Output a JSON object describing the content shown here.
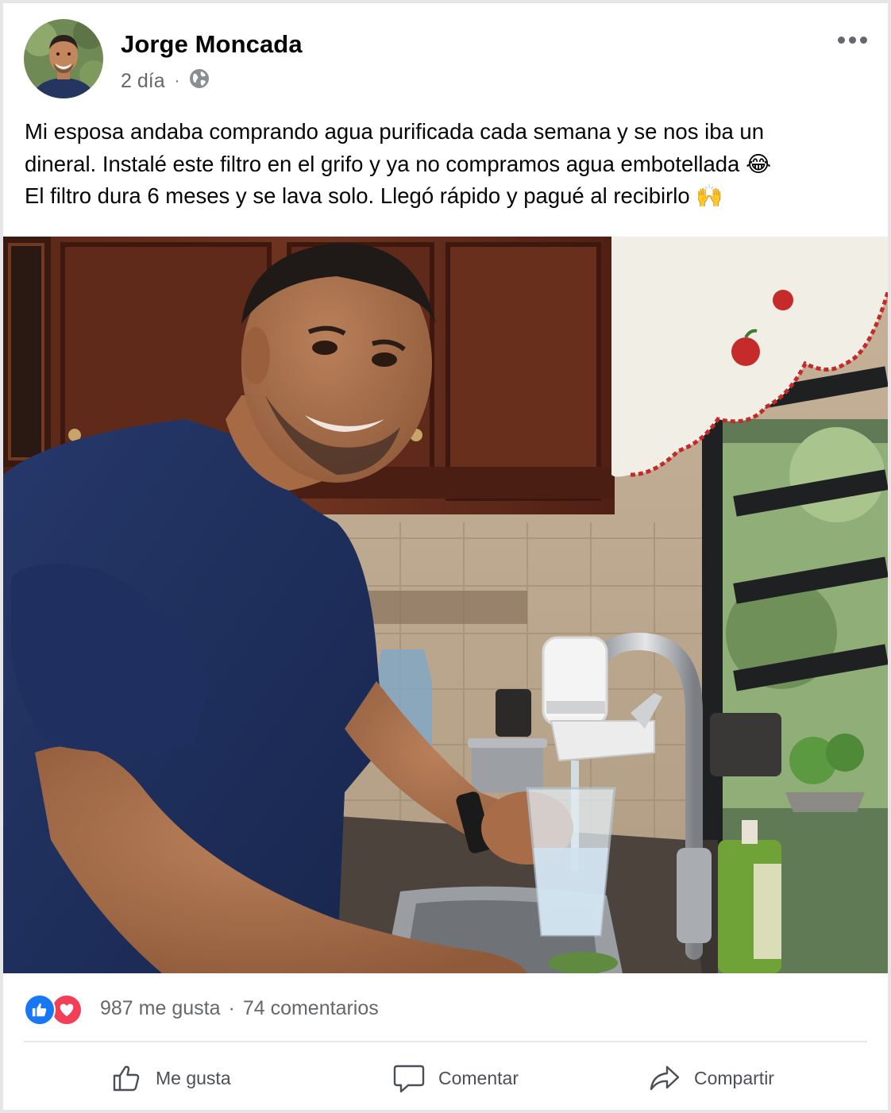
{
  "post": {
    "author": "Jorge Moncada",
    "time": "2 día",
    "separator": "·",
    "privacy_icon": "globe-icon",
    "text_lines": [
      "Mi esposa andaba comprando agua purificada cada semana y se nos iba un",
      "dineral. Instalé este filtro en el grifo y ya no compramos agua embotellada 😂",
      "El filtro dura 6 meses y se lava solo. Llegó rápido y pagué al recibirlo 🙌"
    ]
  },
  "reactions": {
    "icons": [
      "like-icon",
      "love-icon"
    ],
    "likes": "987 me gusta",
    "separator": "·",
    "comments": "74 comentarios"
  },
  "actions": {
    "like_label": "Me gusta",
    "comment_label": "Comentar",
    "share_label": "Compartir"
  },
  "colors": {
    "like_blue": "#1877f2",
    "love_red": "#f33e58",
    "secondary_text": "#65676b",
    "shirt_navy": "#1f2f5a"
  }
}
